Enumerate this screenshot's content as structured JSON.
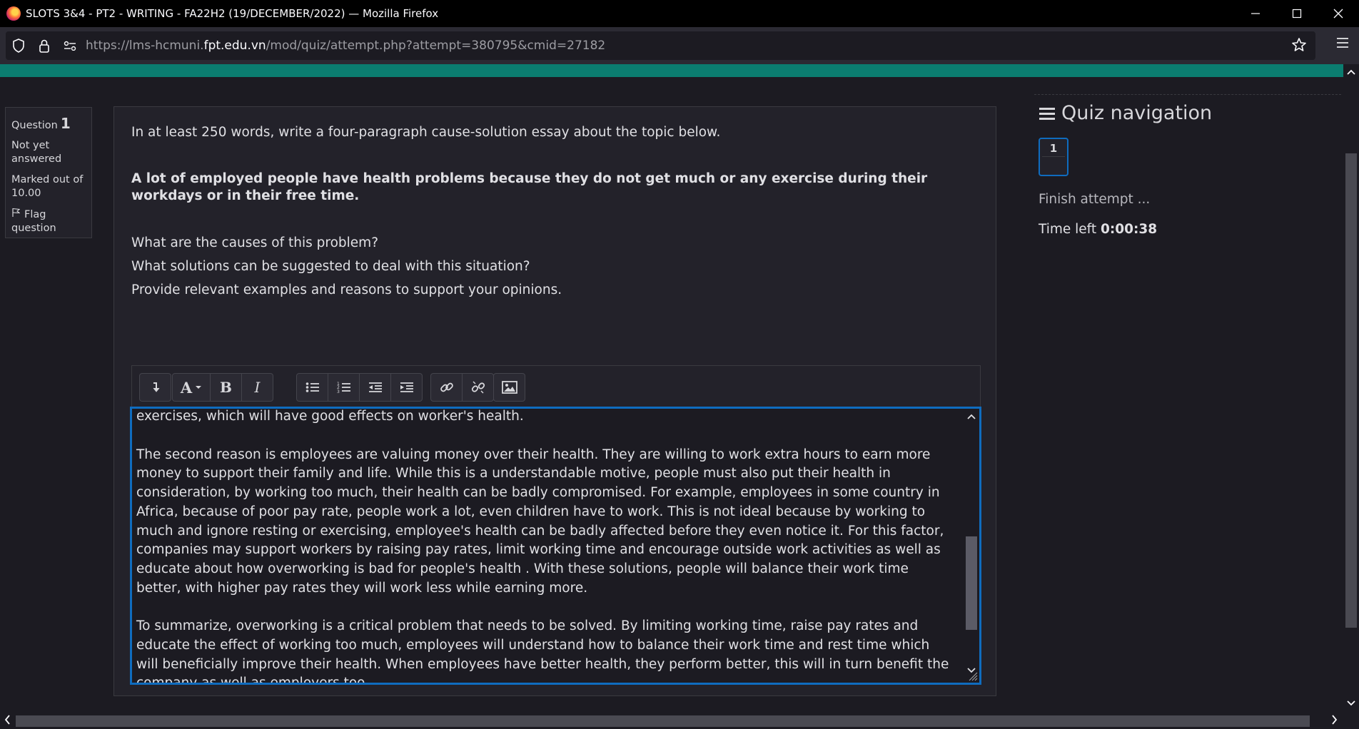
{
  "window": {
    "title": "SLOTS 3&4 - PT2 - WRITING - FA22H2 (19/DECEMBER/2022) — Mozilla Firefox"
  },
  "urlbar": {
    "prefix": "https://lms-hcmuni.",
    "domain": "fpt.edu.vn",
    "path": "/mod/quiz/attempt.php?attempt=380795&cmid=27182"
  },
  "question_info": {
    "label": "Question",
    "number": "1",
    "state": "Not yet answered",
    "marked": "Marked out of 10.00",
    "flag": "Flag question"
  },
  "question": {
    "instruction": "In at least 250 words, write a four-paragraph cause-solution essay about the topic below.",
    "topic": "A lot of employed people have health problems because they do not get much or any exercise during their workdays or in their free time.",
    "prompt1": "What are the causes of this problem?",
    "prompt2": "What solutions can be suggested to deal with this situation?",
    "prompt3": "Provide relevant examples and reasons to support your opinions."
  },
  "editor": {
    "toolbar_icons": [
      "collapse-icon",
      "font-color-icon",
      "bold-icon",
      "italic-icon",
      "bullet-list-icon",
      "numbered-list-icon",
      "outdent-icon",
      "indent-icon",
      "link-icon",
      "unlink-icon",
      "image-icon"
    ],
    "para1_tail": "exercises, which will have good effects on worker's health.",
    "para2": "The second reason is employees are valuing money over their health. They are willing to work extra hours to earn more money to support their family and life. While this is a understandable motive, people must also put their health in consideration, by working too much, their health can be badly compromised. For example, employees in some country in Africa, because of poor pay rate, people work a lot, even children have to work. This is not ideal because by working to much and ignore resting or exercising, employee's health can be badly affected before they even notice it. For this factor, companies may support workers by raising pay rates, limit working time and encourage outside work activities as well as educate about how overworking is bad for people's health . With these solutions, people will balance their work time better, with higher pay rates they will work less while earning more.",
    "para3": "To summarize, overworking is a critical problem that needs to be solved. By limiting working time, raise pay rates and educate the effect of working too much, employees will understand how to balance their work time and rest time which will beneficially improve their health. When employees have better health, they perform better, this will in turn benefit the company as well as employers too."
  },
  "quiz_nav": {
    "title": "Quiz navigation",
    "button": "1",
    "finish": "Finish attempt ...",
    "time_label": "Time left",
    "time_value": "0:00:38"
  },
  "colors": {
    "accent": "#0f6cbf",
    "header_strip": "#0b7d70",
    "background": "#1c1b22"
  }
}
